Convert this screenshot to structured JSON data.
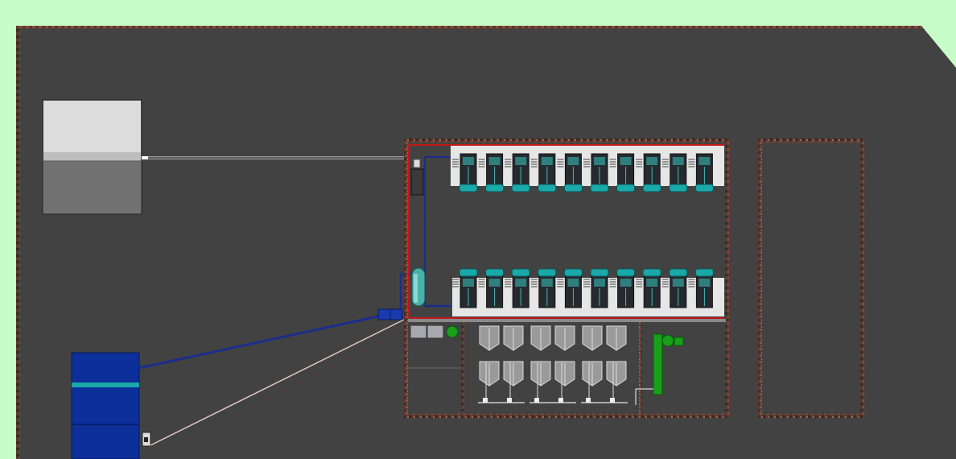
{
  "scene": {
    "background": "#c8fcc8",
    "floor_color": "#424242",
    "wall_color": "#6b3a2c",
    "pipe_blue": "#1a2e8c",
    "pipe_red": "#c41818",
    "panel_teal": "#1aa8a8",
    "tank_blue": "#0d2f9a",
    "equipment_green": "#18a018",
    "unit_rows": [
      {
        "name": "upper-row",
        "units": 10
      },
      {
        "name": "lower-row",
        "units": 10
      }
    ],
    "vessel_units": 3
  }
}
